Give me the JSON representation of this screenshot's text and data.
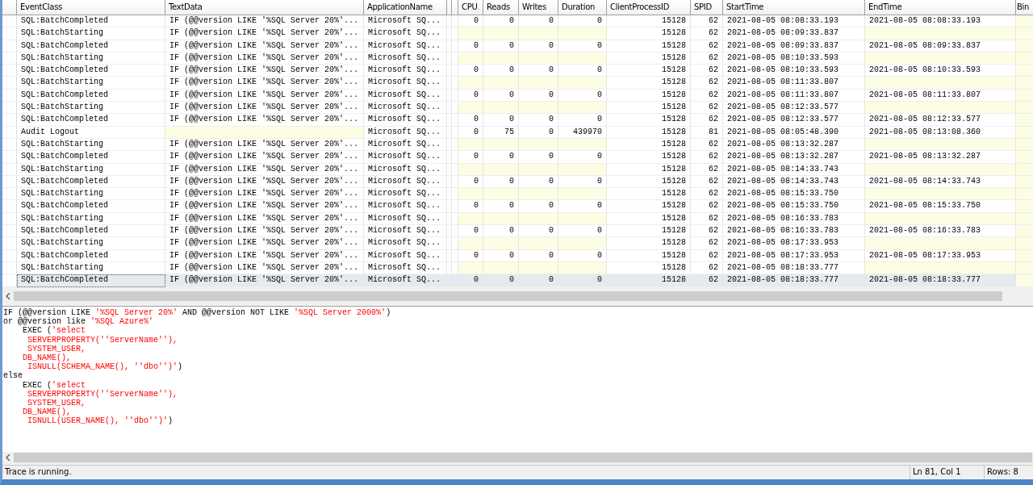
{
  "table": {
    "columns": [
      "EventClass",
      "TextData",
      "ApplicationName",
      "CPU",
      "Reads",
      "Writes",
      "Duration",
      "ClientProcessID",
      "SPID",
      "StartTime",
      "EndTime",
      "Bin"
    ],
    "rows": [
      {
        "event": "SQL:BatchCompleted",
        "text": "IF (@@version LIKE '%SQL Server 20%'...",
        "app": "Microsoft SQ...",
        "cpu": "0",
        "reads": "0",
        "writes": "0",
        "duration": "0",
        "pid": "15128",
        "spid": "62",
        "start": "2021-08-05 08:08:33.193",
        "end": "2021-08-05 08:08:33.193",
        "selected": false
      },
      {
        "event": "SQL:BatchStarting",
        "text": "IF (@@version LIKE '%SQL Server 20%'...",
        "app": "Microsoft SQ...",
        "pid": "15128",
        "spid": "62",
        "start": "2021-08-05 08:09:33.837",
        "selected": false
      },
      {
        "event": "SQL:BatchCompleted",
        "text": "IF (@@version LIKE '%SQL Server 20%'...",
        "app": "Microsoft SQ...",
        "cpu": "0",
        "reads": "0",
        "writes": "0",
        "duration": "0",
        "pid": "15128",
        "spid": "62",
        "start": "2021-08-05 08:09:33.837",
        "end": "2021-08-05 08:09:33.837",
        "selected": false
      },
      {
        "event": "SQL:BatchStarting",
        "text": "IF (@@version LIKE '%SQL Server 20%'...",
        "app": "Microsoft SQ...",
        "pid": "15128",
        "spid": "62",
        "start": "2021-08-05 08:10:33.593",
        "selected": false
      },
      {
        "event": "SQL:BatchCompleted",
        "text": "IF (@@version LIKE '%SQL Server 20%'...",
        "app": "Microsoft SQ...",
        "cpu": "0",
        "reads": "0",
        "writes": "0",
        "duration": "0",
        "pid": "15128",
        "spid": "62",
        "start": "2021-08-05 08:10:33.593",
        "end": "2021-08-05 08:10:33.593",
        "selected": false
      },
      {
        "event": "SQL:BatchStarting",
        "text": "IF (@@version LIKE '%SQL Server 20%'...",
        "app": "Microsoft SQ...",
        "pid": "15128",
        "spid": "62",
        "start": "2021-08-05 08:11:33.807",
        "selected": false
      },
      {
        "event": "SQL:BatchCompleted",
        "text": "IF (@@version LIKE '%SQL Server 20%'...",
        "app": "Microsoft SQ...",
        "cpu": "0",
        "reads": "0",
        "writes": "0",
        "duration": "0",
        "pid": "15128",
        "spid": "62",
        "start": "2021-08-05 08:11:33.807",
        "end": "2021-08-05 08:11:33.807",
        "selected": false
      },
      {
        "event": "SQL:BatchStarting",
        "text": "IF (@@version LIKE '%SQL Server 20%'...",
        "app": "Microsoft SQ...",
        "pid": "15128",
        "spid": "62",
        "start": "2021-08-05 08:12:33.577",
        "selected": false
      },
      {
        "event": "SQL:BatchCompleted",
        "text": "IF (@@version LIKE '%SQL Server 20%'...",
        "app": "Microsoft SQ...",
        "cpu": "0",
        "reads": "0",
        "writes": "0",
        "duration": "0",
        "pid": "15128",
        "spid": "62",
        "start": "2021-08-05 08:12:33.577",
        "end": "2021-08-05 08:12:33.577",
        "selected": false
      },
      {
        "event": "Audit Logout",
        "app": "Microsoft SQ...",
        "cpu": "0",
        "reads": "75",
        "writes": "0",
        "duration": "439970",
        "pid": "15128",
        "spid": "81",
        "start": "2021-08-05 08:05:48.390",
        "end": "2021-08-05 08:13:08.360",
        "selected": false
      },
      {
        "event": "SQL:BatchStarting",
        "text": "IF (@@version LIKE '%SQL Server 20%'...",
        "app": "Microsoft SQ...",
        "pid": "15128",
        "spid": "62",
        "start": "2021-08-05 08:13:32.287",
        "selected": false
      },
      {
        "event": "SQL:BatchCompleted",
        "text": "IF (@@version LIKE '%SQL Server 20%'...",
        "app": "Microsoft SQ...",
        "cpu": "0",
        "reads": "0",
        "writes": "0",
        "duration": "0",
        "pid": "15128",
        "spid": "62",
        "start": "2021-08-05 08:13:32.287",
        "end": "2021-08-05 08:13:32.287",
        "selected": false
      },
      {
        "event": "SQL:BatchStarting",
        "text": "IF (@@version LIKE '%SQL Server 20%'...",
        "app": "Microsoft SQ...",
        "pid": "15128",
        "spid": "62",
        "start": "2021-08-05 08:14:33.743",
        "selected": false
      },
      {
        "event": "SQL:BatchCompleted",
        "text": "IF (@@version LIKE '%SQL Server 20%'...",
        "app": "Microsoft SQ...",
        "cpu": "0",
        "reads": "0",
        "writes": "0",
        "duration": "0",
        "pid": "15128",
        "spid": "62",
        "start": "2021-08-05 08:14:33.743",
        "end": "2021-08-05 08:14:33.743",
        "selected": false
      },
      {
        "event": "SQL:BatchStarting",
        "text": "IF (@@version LIKE '%SQL Server 20%'...",
        "app": "Microsoft SQ...",
        "pid": "15128",
        "spid": "62",
        "start": "2021-08-05 08:15:33.750",
        "selected": false
      },
      {
        "event": "SQL:BatchCompleted",
        "text": "IF (@@version LIKE '%SQL Server 20%'...",
        "app": "Microsoft SQ...",
        "cpu": "0",
        "reads": "0",
        "writes": "0",
        "duration": "0",
        "pid": "15128",
        "spid": "62",
        "start": "2021-08-05 08:15:33.750",
        "end": "2021-08-05 08:15:33.750",
        "selected": false
      },
      {
        "event": "SQL:BatchStarting",
        "text": "IF (@@version LIKE '%SQL Server 20%'...",
        "app": "Microsoft SQ...",
        "pid": "15128",
        "spid": "62",
        "start": "2021-08-05 08:16:33.783",
        "selected": false
      },
      {
        "event": "SQL:BatchCompleted",
        "text": "IF (@@version LIKE '%SQL Server 20%'...",
        "app": "Microsoft SQ...",
        "cpu": "0",
        "reads": "0",
        "writes": "0",
        "duration": "0",
        "pid": "15128",
        "spid": "62",
        "start": "2021-08-05 08:16:33.783",
        "end": "2021-08-05 08:16:33.783",
        "selected": false
      },
      {
        "event": "SQL:BatchStarting",
        "text": "IF (@@version LIKE '%SQL Server 20%'...",
        "app": "Microsoft SQ...",
        "pid": "15128",
        "spid": "62",
        "start": "2021-08-05 08:17:33.953",
        "selected": false
      },
      {
        "event": "SQL:BatchCompleted",
        "text": "IF (@@version LIKE '%SQL Server 20%'...",
        "app": "Microsoft SQ...",
        "cpu": "0",
        "reads": "0",
        "writes": "0",
        "duration": "0",
        "pid": "15128",
        "spid": "62",
        "start": "2021-08-05 08:17:33.953",
        "end": "2021-08-05 08:17:33.953",
        "selected": false
      },
      {
        "event": "SQL:BatchStarting",
        "text": "IF (@@version LIKE '%SQL Server 20%'...",
        "app": "Microsoft SQ...",
        "pid": "15128",
        "spid": "62",
        "start": "2021-08-05 08:18:33.777",
        "selected": false
      },
      {
        "event": "SQL:BatchCompleted",
        "text": "IF (@@version LIKE '%SQL Server 20%'...",
        "app": "Microsoft SQ...",
        "cpu": "0",
        "reads": "0",
        "writes": "0",
        "duration": "0",
        "pid": "15128",
        "spid": "62",
        "start": "2021-08-05 08:18:33.777",
        "end": "2021-08-05 08:18:33.777",
        "selected": true
      }
    ]
  },
  "detail": {
    "lines": [
      [
        {
          "kind": "code",
          "text": "IF (@@version LIKE "
        },
        {
          "kind": "string",
          "text": "'%SQL Server 20%'"
        },
        {
          "kind": "code",
          "text": " AND @@version NOT LIKE "
        },
        {
          "kind": "string",
          "text": "'%SQL Server 2000%'"
        },
        {
          "kind": "code",
          "text": ")"
        }
      ],
      [
        {
          "kind": "code",
          "text": "or @@version like "
        },
        {
          "kind": "string",
          "text": "'%SQL Azure%'"
        }
      ],
      [
        {
          "kind": "code",
          "text": "    EXEC ("
        },
        {
          "kind": "string",
          "text": "'select"
        }
      ],
      [
        {
          "kind": "string",
          "text": "     SERVERPROPERTY(''ServerName''),"
        }
      ],
      [
        {
          "kind": "string",
          "text": "     SYSTEM_USER,"
        }
      ],
      [
        {
          "kind": "string",
          "text": "    DB_NAME(),"
        }
      ],
      [
        {
          "kind": "string",
          "text": "     ISNULL(SCHEMA_NAME(), ''dbo'')'"
        },
        {
          "kind": "code",
          "text": ")"
        }
      ],
      [
        {
          "kind": "code",
          "text": "else"
        }
      ],
      [
        {
          "kind": "code",
          "text": "    EXEC ("
        },
        {
          "kind": "string",
          "text": "'select"
        }
      ],
      [
        {
          "kind": "string",
          "text": "     SERVERPROPERTY(''ServerName''),"
        }
      ],
      [
        {
          "kind": "string",
          "text": "     SYSTEM_USER,"
        }
      ],
      [
        {
          "kind": "string",
          "text": "    DB_NAME(),"
        }
      ],
      [
        {
          "kind": "string",
          "text": "     ISNULL(USER_NAME(), ''dbo'')'"
        },
        {
          "kind": "code",
          "text": ")"
        }
      ]
    ]
  },
  "status_bar": {
    "message": "Trace is running.",
    "position": "Ln 81, Col 1",
    "rows": "Rows: 8"
  }
}
